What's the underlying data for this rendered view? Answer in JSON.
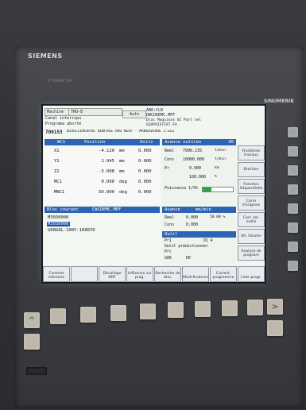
{
  "panel": {
    "brand": "SIEMENS",
    "subbrand": "2°PONER   TLM",
    "model": "SINUMERIK"
  },
  "header": {
    "machine_label": "Machine",
    "machine_value": "TRO-8",
    "reset_row": "Canal interrupu",
    "prog_row": "Programa aborté",
    "mode_label": "Auto",
    "program_path": "AN0:CLR",
    "program_name": "DWCD6EMC.MPF",
    "alarm_id": "700153",
    "alarm_text": "NIVELLEMENTDE RENFUGE HAU NEUF - MANGOVEURE L:ELE",
    "status_right_1": "Dlac Maquinas UC Part nel",
    "status_right_2": "GEOPOISTEXT.FA"
  },
  "wcs": {
    "title": "WCS",
    "col_position": "Position",
    "col_units": "Units",
    "rows": [
      {
        "axis": "X1",
        "value": "-4.120",
        "unit": "mm",
        "dist": "0.000"
      },
      {
        "axis": "Y1",
        "value": "1.945",
        "unit": "mm",
        "dist": "0.000"
      },
      {
        "axis": "Z1",
        "value": "-3.008",
        "unit": "mm",
        "dist": "0.000"
      },
      {
        "axis": "MC1",
        "value": "0.000",
        "unit": "deg",
        "dist": "0.000"
      },
      {
        "axis": "MNC1",
        "value": "50.000",
        "unit": "deg",
        "dist": "0.000"
      }
    ]
  },
  "feed": {
    "title": "Avance outsteo",
    "badge": "00",
    "rows": [
      {
        "label": "Reel",
        "value": "7996.135",
        "unit": "t/min"
      },
      {
        "label": "Cons",
        "value": "10000.000",
        "unit": "t/min"
      },
      {
        "label": "Pr",
        "value": "0.000",
        "unit": "km"
      },
      {
        "label": "",
        "value": "100.000",
        "unit": "%"
      }
    ],
    "power_label": "Puissance 1/5%",
    "power_fraction": 0.3
  },
  "program": {
    "title": "Bloc courant",
    "file": "CWCDEMC.MPF",
    "lines": [
      "M3030000",
      "M303D000",
      "G00G0L-100Y-100070"
    ],
    "selected_index": 1
  },
  "spindle": {
    "title": "Avance",
    "unit_header": "mm/min",
    "rows": [
      {
        "label": "Reel",
        "value": "0.000",
        "extra": "50.00 %"
      },
      {
        "label": "Cons",
        "value": "0.000",
        "extra": ""
      }
    ]
  },
  "tool": {
    "title": "Outil",
    "rows": [
      {
        "label": "Pr1",
        "value": "",
        "extra": "D1     4"
      },
      {
        "label": "Outil prédictionner",
        "value": "",
        "extra": ""
      },
      {
        "label": "Prt",
        "value": "",
        "extra": ""
      },
      {
        "label": "G00",
        "value": "D0",
        "extra": ""
      }
    ]
  },
  "softkeys_right": [
    "Frontières travaux",
    "",
    "Brochen",
    "",
    "Fonction Séquentielle",
    "Corre d'origines",
    "Corr. sel. outils",
    "Alt. Gluster",
    "Analyse de program"
  ],
  "softkeys_bottom": [
    "Corrects mémoire",
    "",
    "Décaliage DRF",
    "Influence sur prog.",
    "Recherche de bloc",
    "Modi-ficatives",
    "Correct. programme",
    "Liste progr."
  ],
  "hardkeys": {
    "left_arrow": "^",
    "right_arrow": ">"
  }
}
